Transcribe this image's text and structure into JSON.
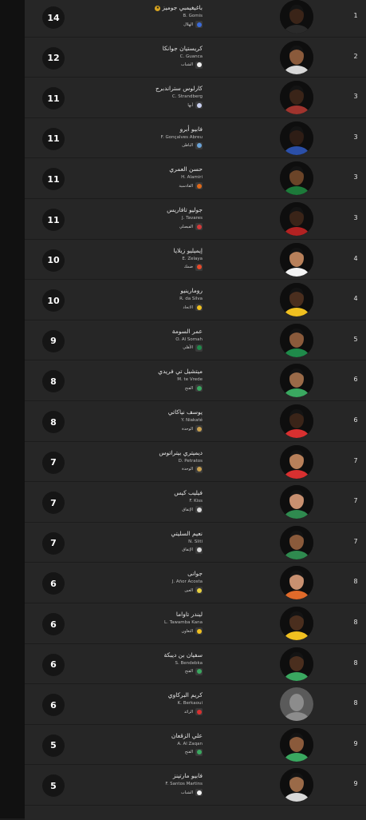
{
  "players": [
    {
      "goals": "14",
      "name_ar": "باغيغيمبي جوميز",
      "name_en": "B. Gomis",
      "team": "الهلال",
      "rank": "1",
      "crest_color": "#3b6bd8",
      "skin": "#3a2418",
      "shirt": "#2a2a2a",
      "star": true
    },
    {
      "goals": "12",
      "name_ar": "كريستيان جوانكا",
      "name_en": "C. Guanca",
      "team": "الشباب",
      "rank": "2",
      "crest_color": "#f2f2f2",
      "skin": "#8a5a3b",
      "shirt": "#d8d8d8",
      "star": false
    },
    {
      "goals": "11",
      "name_ar": "كارلوس ستراندبرج",
      "name_en": "C. Strandberg",
      "team": "أبها",
      "rank": "3",
      "crest_color": "#c9d0f0",
      "skin": "#3a2418",
      "shirt": "#a0342e",
      "star": false
    },
    {
      "goals": "11",
      "name_ar": "فابيو أبرو",
      "name_en": "F. Gonçalves Abreu",
      "team": "الباطن",
      "rank": "3",
      "crest_color": "#6aa3d8",
      "skin": "#2e1d15",
      "shirt": "#2b4fa8",
      "star": false
    },
    {
      "goals": "11",
      "name_ar": "حسن العمري",
      "name_en": "H. Alamiri",
      "team": "القادسية",
      "rank": "3",
      "crest_color": "#e06a1a",
      "skin": "#6b4428",
      "shirt": "#1d7a3a",
      "star": false
    },
    {
      "goals": "11",
      "name_ar": "جوليو تافاريس",
      "name_en": "J. Tavares",
      "team": "الفيصلي",
      "rank": "3",
      "crest_color": "#d23a3a",
      "skin": "#3a2418",
      "shirt": "#b22222",
      "star": false
    },
    {
      "goals": "10",
      "name_ar": "إيميليو زيلايا",
      "name_en": "E. Zelaya",
      "team": "ضمك",
      "rank": "4",
      "crest_color": "#e84a2a",
      "skin": "#b8805a",
      "shirt": "#f2f2f2",
      "star": false
    },
    {
      "goals": "10",
      "name_ar": "رومارينيو",
      "name_en": "R. da Silva",
      "team": "الاتحاد",
      "rank": "4",
      "crest_color": "#f0c020",
      "skin": "#4a2e1e",
      "shirt": "#f0c020",
      "star": false
    },
    {
      "goals": "9",
      "name_ar": "عمر السومة",
      "name_en": "O. Al Somah",
      "team": "الأهلي",
      "rank": "5",
      "crest_color": "#1f8a4a",
      "skin": "#8a5a3b",
      "shirt": "#1f8a4a",
      "star": false
    },
    {
      "goals": "8",
      "name_ar": "ميتشيل تي فريدي",
      "name_en": "M. te Vrede",
      "team": "الفتح",
      "rank": "6",
      "crest_color": "#3aa860",
      "skin": "#9a6a48",
      "shirt": "#3aa860",
      "star": false
    },
    {
      "goals": "8",
      "name_ar": "يوسف نياكاتي",
      "name_en": "Y. Niakaté",
      "team": "الوحدة",
      "rank": "6",
      "crest_color": "#c8a050",
      "skin": "#3a2418",
      "shirt": "#d83030",
      "star": false
    },
    {
      "goals": "7",
      "name_ar": "ديميتري بيتراتوس",
      "name_en": "D. Petratos",
      "team": "الوحدة",
      "rank": "7",
      "crest_color": "#c8a050",
      "skin": "#b8805a",
      "shirt": "#d83030",
      "star": false
    },
    {
      "goals": "7",
      "name_ar": "فيليب كيس",
      "name_en": "F. Kiss",
      "team": "الإتفاق",
      "rank": "7",
      "crest_color": "#d8d8d8",
      "skin": "#c89070",
      "shirt": "#2f8a4f",
      "star": false
    },
    {
      "goals": "7",
      "name_ar": "نعيم السليتي",
      "name_en": "N. Sliti",
      "team": "الإتفاق",
      "rank": "7",
      "crest_color": "#d8d8d8",
      "skin": "#8a5a3b",
      "shirt": "#2f8a4f",
      "star": false
    },
    {
      "goals": "6",
      "name_ar": "جوانى",
      "name_en": "J. Añor Acosta",
      "team": "العين",
      "rank": "8",
      "crest_color": "#e8d040",
      "skin": "#c89070",
      "shirt": "#e06a2a",
      "star": false
    },
    {
      "goals": "6",
      "name_ar": "ليندر تاواما",
      "name_en": "L. Tawamba Kana",
      "team": "التعاون",
      "rank": "8",
      "crest_color": "#f0c020",
      "skin": "#4a2e1e",
      "shirt": "#f0c020",
      "star": false
    },
    {
      "goals": "6",
      "name_ar": "سفيان بن ديبكة",
      "name_en": "S. Bendebka",
      "team": "الفتح",
      "rank": "8",
      "crest_color": "#3aa860",
      "skin": "#4a2e1e",
      "shirt": "#3aa860",
      "star": false
    },
    {
      "goals": "6",
      "name_ar": "كريم البركاوي",
      "name_en": "K. Berkaoui",
      "team": "الرائد",
      "rank": "8",
      "crest_color": "#d83030",
      "skin": "#8c8c8c",
      "shirt": "#8c8c8c",
      "star": false,
      "placeholder": true
    },
    {
      "goals": "5",
      "name_ar": "علي الزقعان",
      "name_en": "A. Al Zaqan",
      "team": "الفتح",
      "rank": "9",
      "crest_color": "#3aa860",
      "skin": "#8a5a3b",
      "shirt": "#3aa860",
      "star": false
    },
    {
      "goals": "5",
      "name_ar": "فابيو مارتينز",
      "name_en": "F. Santos Martins",
      "team": "الشباب",
      "rank": "9",
      "crest_color": "#f2f2f2",
      "skin": "#9a6a48",
      "shirt": "#d8d8d8",
      "star": false
    }
  ]
}
